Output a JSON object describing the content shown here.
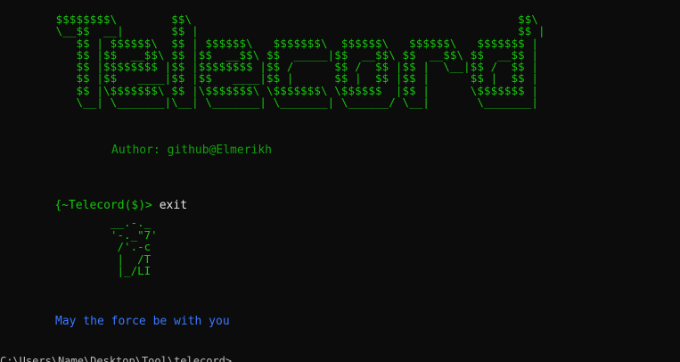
{
  "terminal": {
    "top_fragment": "' '  '   '  '",
    "banner": " $$$$$$$$\\        $$\\                                                $$\\\n \\__$$  __|       $$ |                                               $$ |\n    $$ | $$$$$$\\  $$ | $$$$$$\\   $$$$$$$\\  $$$$$$\\   $$$$$$\\   $$$$$$$ |\n    $$ |$$  __$$\\ $$ |$$  __$$\\ $$  _____|$$  __$$\\ $$  __$$\\ $$  __$$ |\n    $$ |$$$$$$$$ |$$ |$$$$$$$$ |$$ /      $$ /  $$ |$$ |  \\__|$$ /  $$ |\n    $$ |$$   ____|$$ |$$   ____|$$ |      $$ |  $$ |$$ |      $$ |  $$ |\n    $$ |\\$$$$$$$\\ $$ |\\$$$$$$$\\ \\$$$$$$$\\ \\$$$$$$  |$$ |      \\$$$$$$$ |\n    \\__| \\_______|\\__| \\_______| \\_______| \\______/ \\__|       \\_______|",
    "author": "Author: github@Elmerikh",
    "prompt": "{~Telecord($)>",
    "command": " exit",
    "yoda": "__.-._\n'-._\"7'\n /'.-c\n |  /T\n |_/LI",
    "farewell": "May the force be with you",
    "last_line": "C:\\Users\\Name\\Desktop\\Tool\\telecord>"
  },
  "colors": {
    "background": "#0c0c0c",
    "banner_green": "#16c60c",
    "author_green": "#13a10e",
    "farewell_blue": "#3b78ff",
    "command_text": "#e8e8e8"
  }
}
